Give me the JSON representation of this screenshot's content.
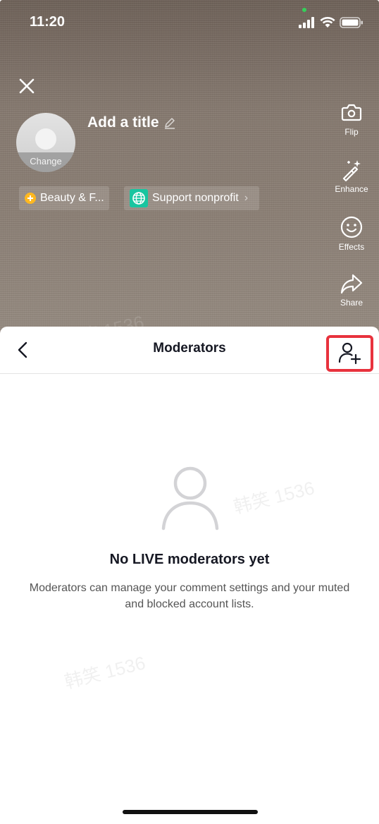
{
  "status_bar": {
    "time": "11:20"
  },
  "stream_setup": {
    "cover_label": "Change",
    "title_placeholder": "Add a title",
    "chips": [
      {
        "label": "Beauty & F..."
      },
      {
        "label": "Support nonprofit"
      }
    ],
    "tools": [
      {
        "label": "Flip",
        "icon": "flip-camera-icon"
      },
      {
        "label": "Enhance",
        "icon": "magic-wand-icon"
      },
      {
        "label": "Effects",
        "icon": "smiley-icon"
      },
      {
        "label": "Share",
        "icon": "share-arrow-icon"
      }
    ]
  },
  "sheet": {
    "title": "Moderators",
    "empty_title": "No LIVE moderators yet",
    "empty_description": "Moderators can manage your comment settings and your muted and blocked account lists."
  },
  "watermark_text": "韩笑 1536",
  "colors": {
    "highlight": "#e8323d",
    "nonprofit_badge": "#18c5a0",
    "beauty_badge": "#ffb81f",
    "text_primary": "#161823"
  }
}
